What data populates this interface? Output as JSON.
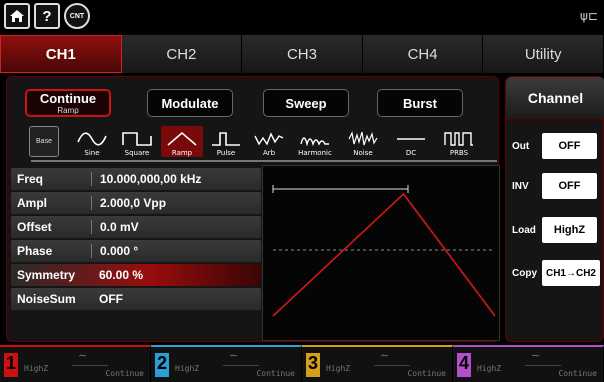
{
  "topbar": {
    "home_icon": "home-icon",
    "help_label": "?",
    "cnt_label": "CNT",
    "usb_icon": "usb-icon"
  },
  "tabs": [
    {
      "label": "CH1",
      "active": true
    },
    {
      "label": "CH2",
      "active": false
    },
    {
      "label": "CH3",
      "active": false
    },
    {
      "label": "CH4",
      "active": false
    },
    {
      "label": "Utility",
      "active": false
    }
  ],
  "modes": {
    "continue": {
      "label": "Continue",
      "sub": "Ramp"
    },
    "modulate": "Modulate",
    "sweep": "Sweep",
    "burst": "Burst"
  },
  "waveforms": {
    "base": "Base",
    "items": [
      "Sine",
      "Square",
      "Ramp",
      "Pulse",
      "Arb",
      "Harmonic",
      "Noise",
      "DC",
      "PRBS"
    ],
    "selected": "Ramp"
  },
  "params": [
    {
      "label": "Freq",
      "value": "10.000,000,00 kHz"
    },
    {
      "label": "Ampl",
      "value": "2.000,0 Vpp"
    },
    {
      "label": "Offset",
      "value": "0.0 mV"
    },
    {
      "label": "Phase",
      "value": "0.000 °"
    },
    {
      "label": "Symmetry",
      "value": "60.00 %"
    },
    {
      "label": "NoiseSum",
      "value": "OFF"
    }
  ],
  "preview": {
    "symmetry_percent": 60
  },
  "channel_panel": {
    "title": "Channel",
    "out": {
      "label": "Out",
      "value": "OFF"
    },
    "inv": {
      "label": "INV",
      "value": "OFF"
    },
    "load": {
      "label": "Load",
      "value": "HighZ"
    },
    "copy": {
      "label": "Copy",
      "value": "CH1→CH2"
    }
  },
  "bottom_channels": [
    {
      "num": "1",
      "load": "HighZ",
      "mode": "Continue",
      "color": "#c11"
    },
    {
      "num": "2",
      "load": "HighZ",
      "mode": "Continue",
      "color": "#2a9fd6"
    },
    {
      "num": "3",
      "load": "HighZ",
      "mode": "Continue",
      "color": "#d4a017"
    },
    {
      "num": "4",
      "load": "HighZ",
      "mode": "Continue",
      "color": "#b44fc9"
    }
  ],
  "colors": {
    "accent": "#c11",
    "bg": "#000"
  }
}
